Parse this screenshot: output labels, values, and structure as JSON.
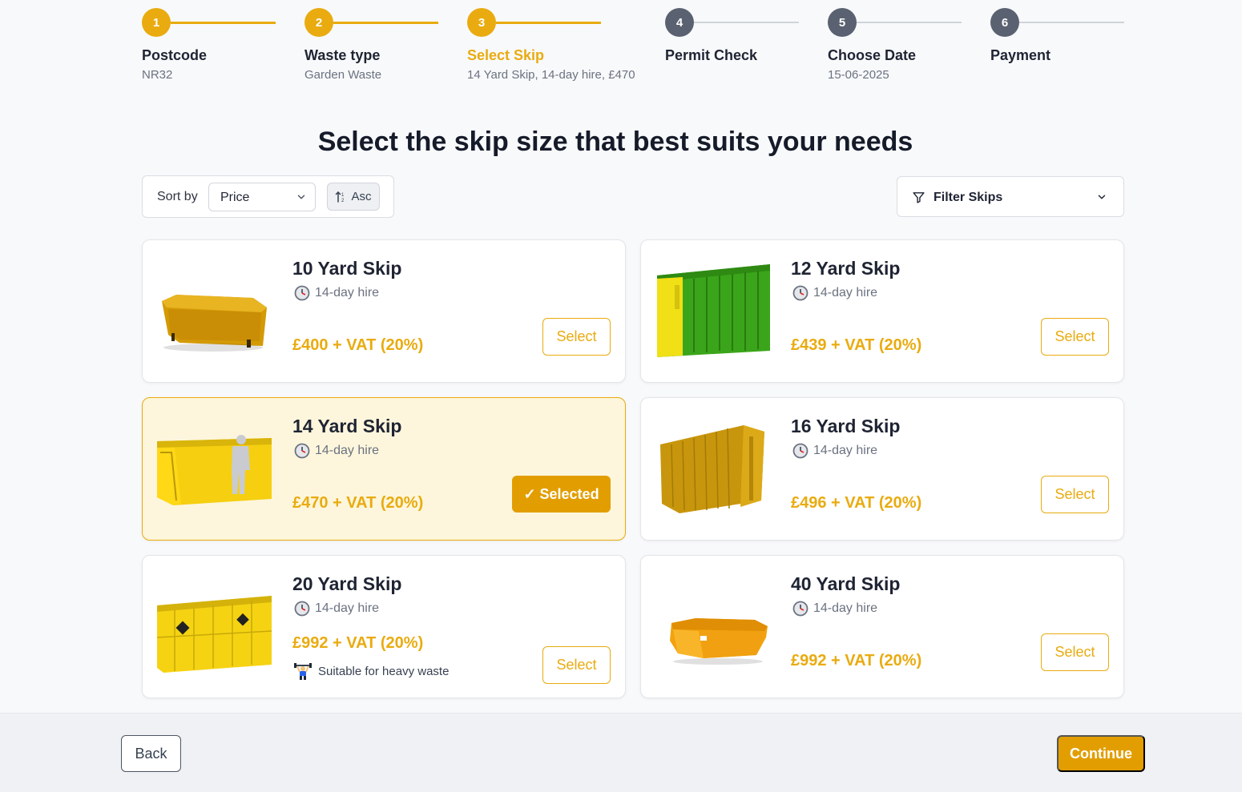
{
  "steps": [
    {
      "number": "1",
      "title": "Postcode",
      "subtitle": "NR32",
      "state": "done"
    },
    {
      "number": "2",
      "title": "Waste type",
      "subtitle": "Garden Waste",
      "state": "done"
    },
    {
      "number": "3",
      "title": "Select Skip",
      "subtitle": "14 Yard Skip, 14-day hire, £470",
      "state": "current"
    },
    {
      "number": "4",
      "title": "Permit Check",
      "subtitle": "",
      "state": "todo"
    },
    {
      "number": "5",
      "title": "Choose Date",
      "subtitle": "15-06-2025",
      "state": "todo"
    },
    {
      "number": "6",
      "title": "Payment",
      "subtitle": "",
      "state": "todo"
    }
  ],
  "heading": "Select the skip size that best suits your needs",
  "sort": {
    "label": "Sort by",
    "selected": "Price",
    "order_label": "Asc"
  },
  "filter": {
    "label": "Filter Skips"
  },
  "skips": [
    {
      "name": "10 Yard Skip",
      "hire": "14-day hire",
      "price": "£400 + VAT (20%)",
      "button": "Select",
      "selected": false,
      "note": ""
    },
    {
      "name": "12 Yard Skip",
      "hire": "14-day hire",
      "price": "£439 + VAT (20%)",
      "button": "Select",
      "selected": false,
      "note": ""
    },
    {
      "name": "14 Yard Skip",
      "hire": "14-day hire",
      "price": "£470 + VAT (20%)",
      "button": "✓ Selected",
      "selected": true,
      "note": ""
    },
    {
      "name": "16 Yard Skip",
      "hire": "14-day hire",
      "price": "£496 + VAT (20%)",
      "button": "Select",
      "selected": false,
      "note": ""
    },
    {
      "name": "20 Yard Skip",
      "hire": "14-day hire",
      "price": "£992 + VAT (20%)",
      "button": "Select",
      "selected": false,
      "note": "Suitable for heavy waste"
    },
    {
      "name": "40 Yard Skip",
      "hire": "14-day hire",
      "price": "£992 + VAT (20%)",
      "button": "Select",
      "selected": false,
      "note": ""
    }
  ],
  "footer": {
    "back_label": "Back",
    "continue_label": "Continue"
  },
  "colors": {
    "accent": "#e9ab0f",
    "accent_dark": "#e29e00",
    "step_todo": "#5a6170"
  },
  "icons": [
    "clock-icon",
    "chevron-down-icon",
    "sort-order-icon",
    "filter-icon",
    "weightlifter-icon"
  ]
}
